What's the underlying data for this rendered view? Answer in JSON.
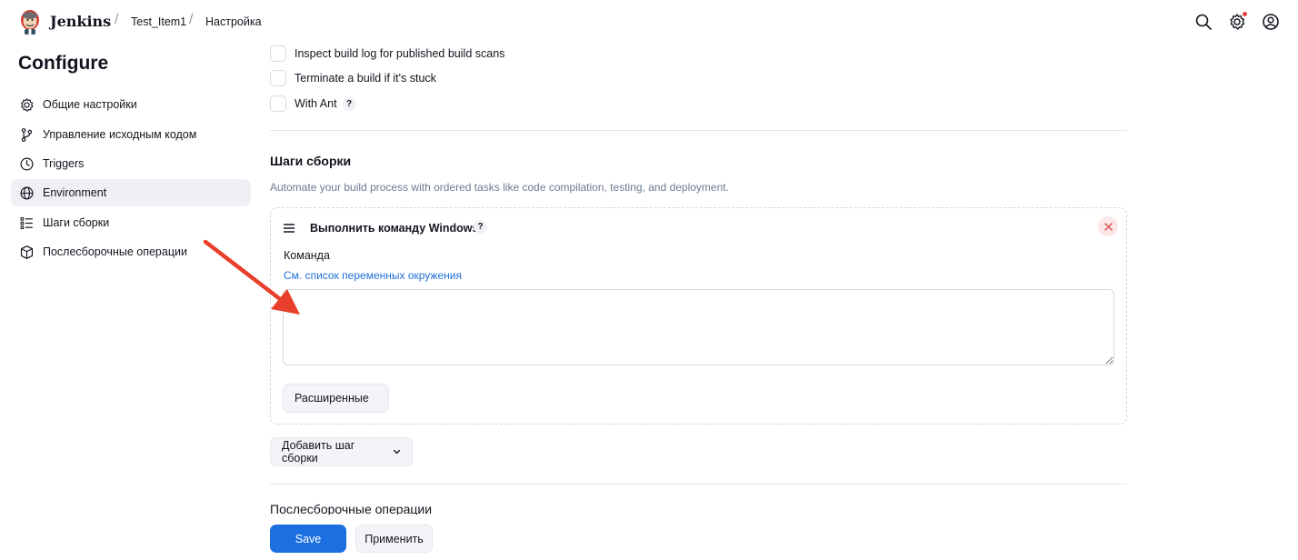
{
  "header": {
    "brand": "Jenkins",
    "breadcrumbs": [
      "Test_Item1",
      "Настройка"
    ],
    "separator": "/",
    "icons": [
      "search-icon",
      "settings-icon",
      "user-icon"
    ],
    "notification_color": "#e5433b"
  },
  "sidebar": {
    "title": "Configure",
    "items": [
      {
        "label": "Общие настройки",
        "icon": "gear-icon",
        "active": false
      },
      {
        "label": "Управление исходным кодом",
        "icon": "branch-icon",
        "active": false
      },
      {
        "label": "Triggers",
        "icon": "clock-icon",
        "active": false
      },
      {
        "label": "Environment",
        "icon": "globe-icon",
        "active": true
      },
      {
        "label": "Шаги сборки",
        "icon": "list-icon",
        "active": false
      },
      {
        "label": "Послесборочные операции",
        "icon": "package-icon",
        "active": false
      }
    ]
  },
  "options": [
    {
      "label": "Inspect build log for published build scans",
      "checked": false,
      "help": false
    },
    {
      "label": "Terminate a build if it's stuck",
      "checked": false,
      "help": false
    },
    {
      "label": "With Ant",
      "checked": false,
      "help": true
    }
  ],
  "help_symbol": "?",
  "build_steps": {
    "title": "Шаги сборки",
    "description": "Automate your build process with ordered tasks like code compilation, testing, and deployment.",
    "step": {
      "title": "Выполнить команду Windows",
      "command_label": "Команда",
      "env_link": "См. список переменных окружения",
      "command_value": "",
      "advanced_label": "Расширенные"
    },
    "add_step_label": "Добавить шаг сборки"
  },
  "next_section_title": "Послесборочные операции",
  "footer": {
    "save_label": "Save",
    "apply_label": "Применить"
  },
  "colors": {
    "primary": "#1c6fe0",
    "link": "#1f6fd6",
    "active_bg": "#eef0f5",
    "annotation_arrow": "#e8402c"
  }
}
